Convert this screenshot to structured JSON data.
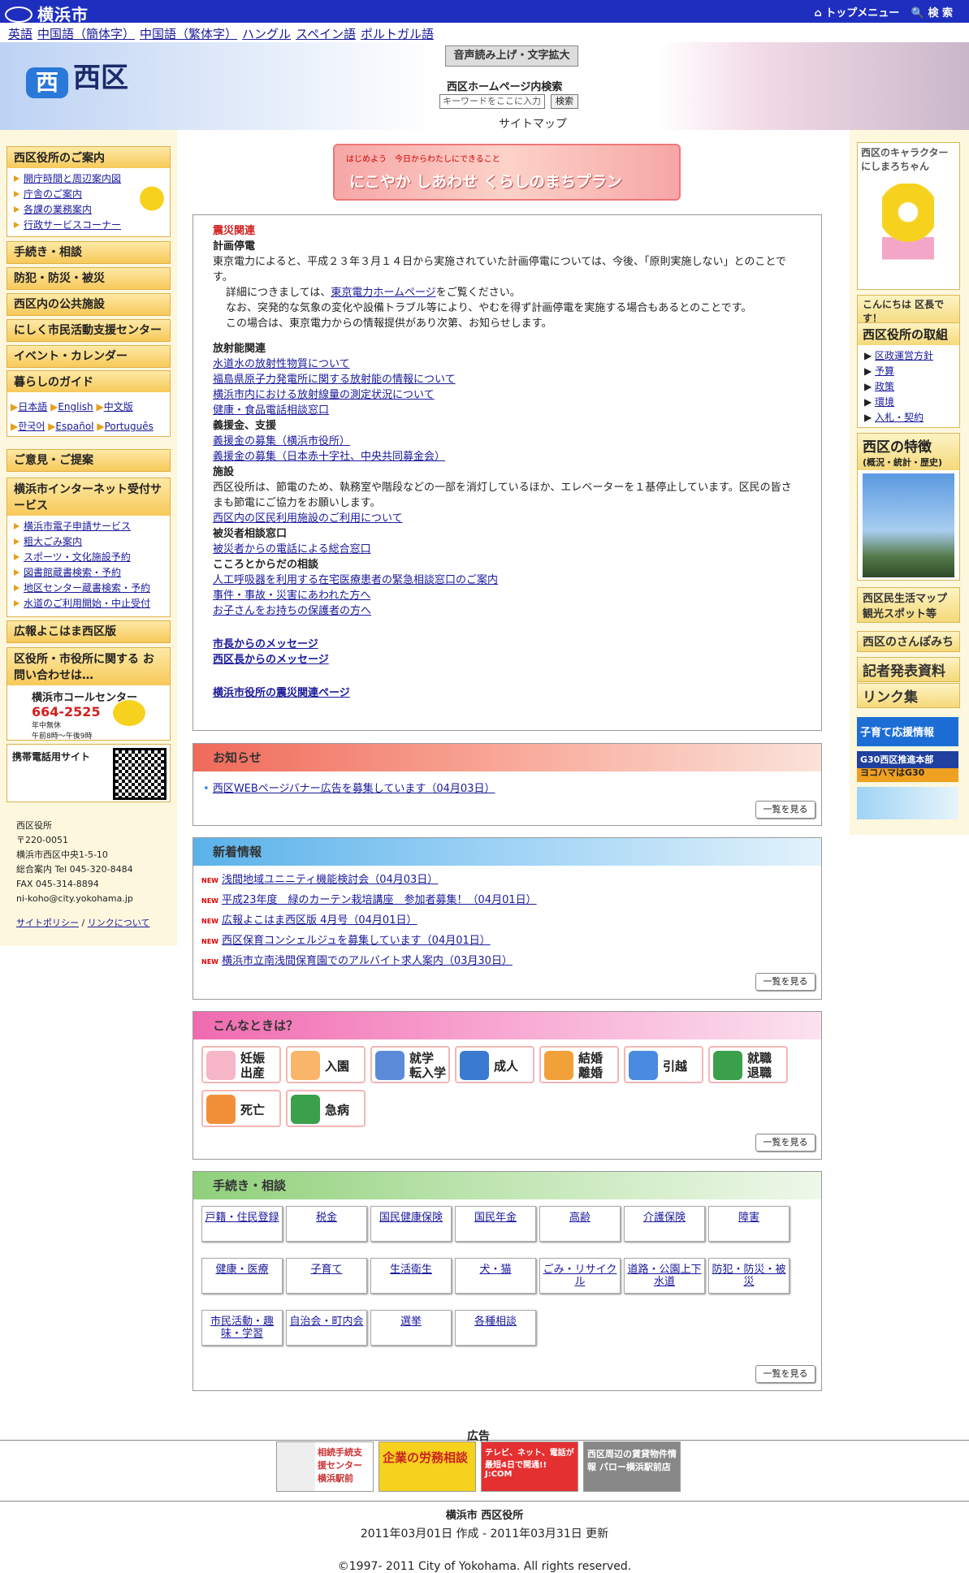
{
  "topbar": {
    "city": "横浜市",
    "top_menu": "トップメニュー",
    "search": "検 索"
  },
  "languages": [
    "英語",
    "中国語（簡体字）",
    "中国語（繁体字）",
    "ハングル",
    "スペイン語",
    "ポルトガル語"
  ],
  "header": {
    "ward": "西区",
    "voice_btn": "音声読み上げ・文字拡大",
    "search_label": "西区ホームページ内検索",
    "search_placeholder": "キーワードをここに入力",
    "search_btn": "検索",
    "sitemap": "サイトマップ"
  },
  "left": {
    "office_title": "西区役所のご案内",
    "office_items": [
      "開庁時間と周辺案内図",
      "庁舎のご案内",
      "各課の業務案内",
      "行政サービスコーナー"
    ],
    "menu": [
      "手続き・相談",
      "防犯・防災・被災",
      "西区内の公共施設",
      "にしく市民活動支援センター",
      "イベント・カレンダー"
    ],
    "guide_title": "暮らしのガイド",
    "guide_langs": [
      "日本語",
      "English",
      "中文版",
      "한국어",
      "Español",
      "Português"
    ],
    "opinion": "ご意見・ご提案",
    "net_title": "横浜市インターネット受付サービス",
    "net_items": [
      "横浜市電子申請サービス",
      "粗大ごみ案内",
      "スポーツ・文化施設予約",
      "図書館蔵書検索・予約",
      "地区センター蔵書検索・予約",
      "水道のご利用開始・中止受付"
    ],
    "kouhou": "広報よこはま西区版",
    "contact_title": "区役所・市役所に関する お問い合わせは…",
    "call_center": "横浜市コールセンター",
    "call_no": "664-2525",
    "call_note1": "年中無休",
    "call_note2": "午前8時〜午後9時",
    "mobile": "携帯電話用サイト",
    "address": [
      "西区役所",
      "〒220-0051",
      "横浜市西区中央1-5-10",
      "総合案内 Tel 045-320-8484",
      "FAX 045-314-8894",
      "ni-koho@city.yokohama.jp"
    ],
    "policy": "サイトポリシー",
    "links": "リンクについて"
  },
  "banner": {
    "small": "はじめよう　今日からわたしにできること",
    "main": "にこやか しあわせ くらしのまちプラン"
  },
  "disaster": {
    "title": "震災関連",
    "h1": "計画停電",
    "p1": "東京電力によると、平成２３年３月１４日から実施されていた計画停電については、今後、「原則実施しない」とのことです。",
    "p2a": "詳細につきましては、",
    "p2link": "東京電力ホームページ",
    "p2b": "をご覧ください。",
    "p3": "なお、突発的な気象の変化や設備トラブル等により、やむを得ず計画停電を実施する場合もあるとのことです。",
    "p4": "この場合は、東京電力からの情報提供があり次第、お知らせします。",
    "h2": "放射能関連",
    "rad": [
      "水道水の放射性物質について",
      "福島県原子力発電所に関する放射能の情報について",
      "横浜市内における放射線量の測定状況について",
      "健康・食品電話相談窓口"
    ],
    "h3": "義援金、支援",
    "aid": [
      "義援金の募集（横浜市役所）",
      "義援金の募集（日本赤十字社、中央共同募金会）"
    ],
    "h4": "施設",
    "fac_text": "西区役所は、節電のため、執務室や階段などの一部を消灯しているほか、エレベーターを１基停止しています。区民の皆さまも節電にご協力をお願いします。",
    "fac_link": "西区内の区民利用施設のご利用について",
    "h5": "被災者相談窓口",
    "victim": "被災者からの電話による総合窓口",
    "h6": "こころとからだの相談",
    "mind": [
      "人工呼吸器を利用する在宅医療患者の緊急相談窓口のご案内",
      "事件・事故・災害にあわれた方へ",
      "お子さんをお持ちの保護者の方へ"
    ],
    "msg1": "市長からのメッセージ",
    "msg2": "西区長からのメッセージ",
    "city_page": "横浜市役所の震災関連ページ"
  },
  "notice": {
    "title": "お知らせ",
    "item": "西区WEBページバナー広告を募集しています（04月03日）",
    "more": "一覧を見る"
  },
  "news": {
    "title": "新着情報",
    "items": [
      "浅間地域ユニニティ機能検討会（04月03日）",
      "平成23年度　緑のカーテン栽培講座　参加者募集！（04月01日）",
      "広報よこはま西区版 4月号（04月01日）",
      "西区保育コンシェルジュを募集しています（04月01日）",
      "横浜市立南浅間保育園でのアルバイト求人案内（03月30日）"
    ],
    "more": "一覧を見る"
  },
  "life": {
    "title": "こんなときは？",
    "items": [
      "妊娠 出産",
      "入園",
      "就学 転入学",
      "成人",
      "結婚 離婚",
      "引越",
      "就職 退職",
      "死亡",
      "急病"
    ],
    "more": "一覧を見る"
  },
  "proc": {
    "title": "手続き・相談",
    "items": [
      "戸籍・住民登録",
      "税金",
      "国民健康保険",
      "国民年金",
      "高齢",
      "介護保険",
      "障害",
      "健康・医療",
      "子育て",
      "生活衛生",
      "犬・猫",
      "ごみ・リサイクル",
      "道路・公園上下水道",
      "防犯・防災・被災",
      "市民活動・趣味・学習",
      "自治会・町内会",
      "選挙",
      "各種相談"
    ],
    "more": "一覧を見る"
  },
  "right": {
    "chara_title": "西区のキャラクター にしまろちゃん",
    "hello": "こんにちは 区長です！",
    "torikumi": "西区役所の取組",
    "tori_items": [
      "区政運営方針",
      "予算",
      "政策",
      "環境",
      "入札・契約"
    ],
    "tokucho": "西区の特徴",
    "tokucho_sub": "(概況・統計・歴史)",
    "map": "西区民生活マップ観光スポット等",
    "sanpo": "西区のさんぽみち",
    "press": "記者発表資料",
    "links": "リンク集",
    "bn1": "子育て応援情報",
    "bn2": "G30西区推進本部",
    "bn3": "ヨコハマはG30"
  },
  "ads": {
    "label": "広告",
    "items": [
      "相続手続支援センター 横浜駅前",
      "企業の労務相談",
      "テレビ、ネット、電話が最短4日で開通!! J:COM",
      "西区周辺の賃貸物件情報 パロー横浜駅前店"
    ]
  },
  "footer": {
    "org": "横浜市 西区役所",
    "dates": "2011年03月01日 作成 - 2011年03月31日 更新",
    "copy": "©1997- 2011 City of Yokohama. All rights reserved."
  },
  "colors": {
    "topbar": "#1e2fbf",
    "notice": "#f06a5a",
    "news": "#5ab2ea",
    "life": "#f06ab0",
    "proc": "#8fd07a"
  }
}
